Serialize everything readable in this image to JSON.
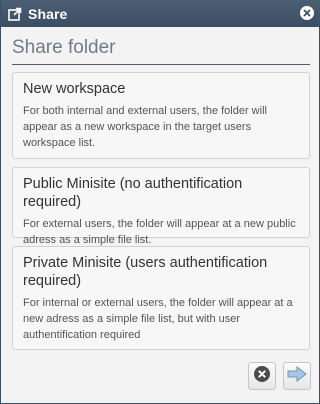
{
  "dialog": {
    "title": "Share",
    "heading": "Share folder",
    "colors": {
      "titlebar": "#3f5268",
      "heading": "#6f7c8a",
      "next_arrow": "#8ab1d6"
    }
  },
  "options": [
    {
      "title": "New workspace",
      "description": "For both internal and external users, the folder will appear as a new workspace in the target users workspace list."
    },
    {
      "title": "Public Minisite (no authentification required)",
      "description": "For external users, the folder will appear at a new public adress as a simple file list."
    },
    {
      "title": "Private Minisite (users authentification required)",
      "description": "For internal or external users, the folder will appear at a new adress as a simple file list, but with user authentification required"
    }
  ],
  "icons": {
    "share": "share-icon",
    "close": "close-icon",
    "cancel": "cancel-circle-icon",
    "next": "arrow-right-icon"
  }
}
